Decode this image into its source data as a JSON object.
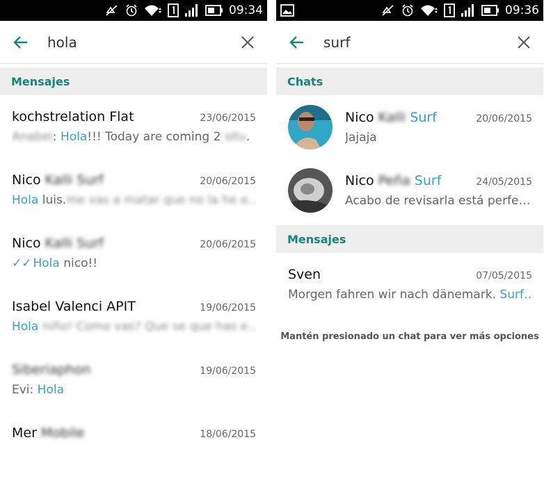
{
  "left": {
    "status_time": "09:34",
    "search_query": "hola",
    "section_label": "Mensajes",
    "messages": [
      {
        "name": "kochstrelation Flat",
        "date": "23/06/2015",
        "pre_blur": "Anabel",
        "pre_plain": ": ",
        "hl": "Hola",
        "post": "!!! Today are coming 2 ",
        "post_blur": "situ",
        "tail": "."
      },
      {
        "name": "Nico ",
        "name_blur": "Kalli Surf",
        "date": "20/06/2015",
        "hl": "Hola",
        "post": " luis.",
        "post_blur": "me vas a matar que no la he e..."
      },
      {
        "name": "Nico ",
        "name_blur": "Kalli Surf",
        "date": "20/06/2015",
        "ticks": "✓✓",
        "hl": "Hola",
        "post": " nico!!"
      },
      {
        "name": "Isabel Valenci APIT",
        "date": "19/06/2015",
        "hl": "Hola",
        "post_blur": " niño! Como vas? Que se que has e..."
      },
      {
        "name_blur": "Siberiaphon",
        "date": "19/06/2015",
        "pre_plain": "Evi: ",
        "hl": "Hola"
      },
      {
        "name": "Mer ",
        "name_blur": "Mobile",
        "date": "18/06/2015"
      }
    ]
  },
  "right": {
    "status_time": "09:36",
    "search_query": "surf",
    "chats_label": "Chats",
    "chats": [
      {
        "name": "Nico ",
        "name_blur": "Kalli",
        "name_hl": " Surf",
        "date": "20/06/2015",
        "snippet": "Jajaja"
      },
      {
        "name": "Nico ",
        "name_blur": "Peña",
        "name_hl": " Surf",
        "date": "24/05/2015",
        "snippet": "Acabo de revisarla está perfe…"
      }
    ],
    "messages_label": "Mensajes",
    "messages": [
      {
        "name": "Sven",
        "date": "07/05/2015",
        "pre": "Morgen fahren wir nach dänemark. ",
        "hl": "Surf…"
      }
    ],
    "hint": "Mantén presionado un chat para ver más opciones"
  },
  "colors": {
    "accent": "#14857a",
    "highlight": "#35a3c8"
  },
  "icons": [
    "mute-icon",
    "alarm-icon",
    "wifi-icon",
    "sim-icon",
    "signal-icon",
    "battery-icon",
    "back-arrow-icon",
    "close-icon",
    "gallery-icon"
  ]
}
